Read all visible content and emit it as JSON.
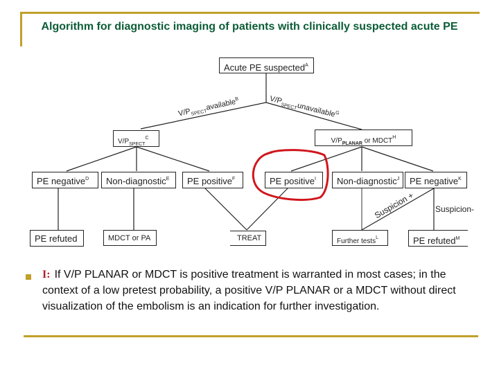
{
  "title": "Algorithm for diagnostic imaging of patients with clinically suspected acute PE",
  "colors": {
    "accent_gold": "#c0a02a",
    "title_green": "#0b5c36",
    "highlight_red": "#d0161c",
    "key_red": "#b01e2a"
  },
  "nodes": {
    "root": {
      "text": "Acute PE suspected",
      "sup": "A"
    },
    "spect": {
      "text": "V/P",
      "sub": "SPECT",
      "sup": "C"
    },
    "planar": {
      "text": "V/P",
      "sub": "PLANAR",
      "after": " or MDCT",
      "sup": "H"
    },
    "spect_negative": {
      "text": "PE negative",
      "sup": "D"
    },
    "spect_nondiagnostic": {
      "text": "Non-diagnostic",
      "sup": "E"
    },
    "spect_positive": {
      "text": "PE positive",
      "sup": "F"
    },
    "planar_positive": {
      "text": "PE positive",
      "sup": "I"
    },
    "planar_nondiagnostic": {
      "text": "Non-diagnostic",
      "sup": "J"
    },
    "planar_negative": {
      "text": "PE negative",
      "sup": "K"
    },
    "pe_refuted_left": {
      "text": "PE refuted"
    },
    "mdct_or_pa": {
      "text": "MDCT or PA"
    },
    "treat": {
      "text": "TREAT"
    },
    "further_tests": {
      "text": "Further tests",
      "sup": "L"
    },
    "pe_refuted_right": {
      "text": "PE refuted",
      "sup": "M"
    }
  },
  "edge_labels": {
    "spect_available": {
      "pre": "V/P",
      "sub": "SPECT",
      "post": "available",
      "sup": "B"
    },
    "spect_unavailable": {
      "pre": "V/P",
      "sub": "SPECT",
      "post": "unavailable",
      "sup": "G"
    },
    "suspicion_plus": "Suspicion +",
    "suspicion_minus": "Suspicion-"
  },
  "highlight": {
    "target": "PE positive I",
    "shape": "hand-drawn red circle"
  },
  "note": {
    "key": "I:",
    "text": "If V/P PLANAR or MDCT is positive treatment is warranted in most cases; in the context of a low pretest probability, a positive V/P PLANAR or a MDCT without direct  visualization of the embolism is an indication for further investigation."
  }
}
